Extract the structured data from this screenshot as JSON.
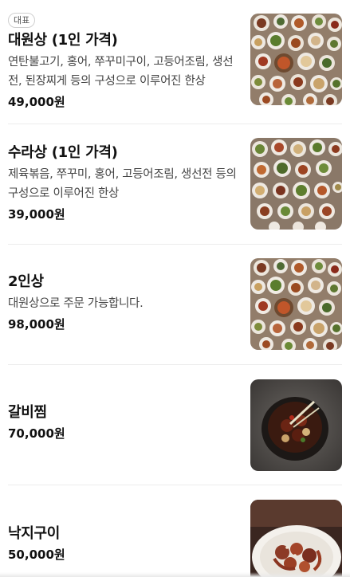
{
  "menu": {
    "items": [
      {
        "badge": "대표",
        "name": "대원상 (1인 가격)",
        "desc": "연탄불고기, 홍어, 쭈꾸미구이, 고등어조림, 생선전, 된장찌게 등의 구성으로 이루어진 한상",
        "price": "49,000원",
        "image": "korean-table-spread"
      },
      {
        "name": "수라상 (1인 가격)",
        "desc": "제육볶음, 쭈꾸미, 홍어, 고등어조림, 생선전 등의 구성으로 이루어진 한상",
        "price": "39,000원",
        "image": "korean-table-spread"
      },
      {
        "name": "2인상",
        "desc": "대원상으로 주문 가능합니다.",
        "price": "98,000원",
        "image": "korean-table-spread"
      },
      {
        "name": "갈비찜",
        "price": "70,000원",
        "image": "braised-short-ribs"
      },
      {
        "name": "낙지구이",
        "price": "50,000원",
        "image": "grilled-octopus"
      }
    ]
  },
  "colors": {
    "text": "#111111",
    "muted": "#444444",
    "divider": "#ececec"
  }
}
